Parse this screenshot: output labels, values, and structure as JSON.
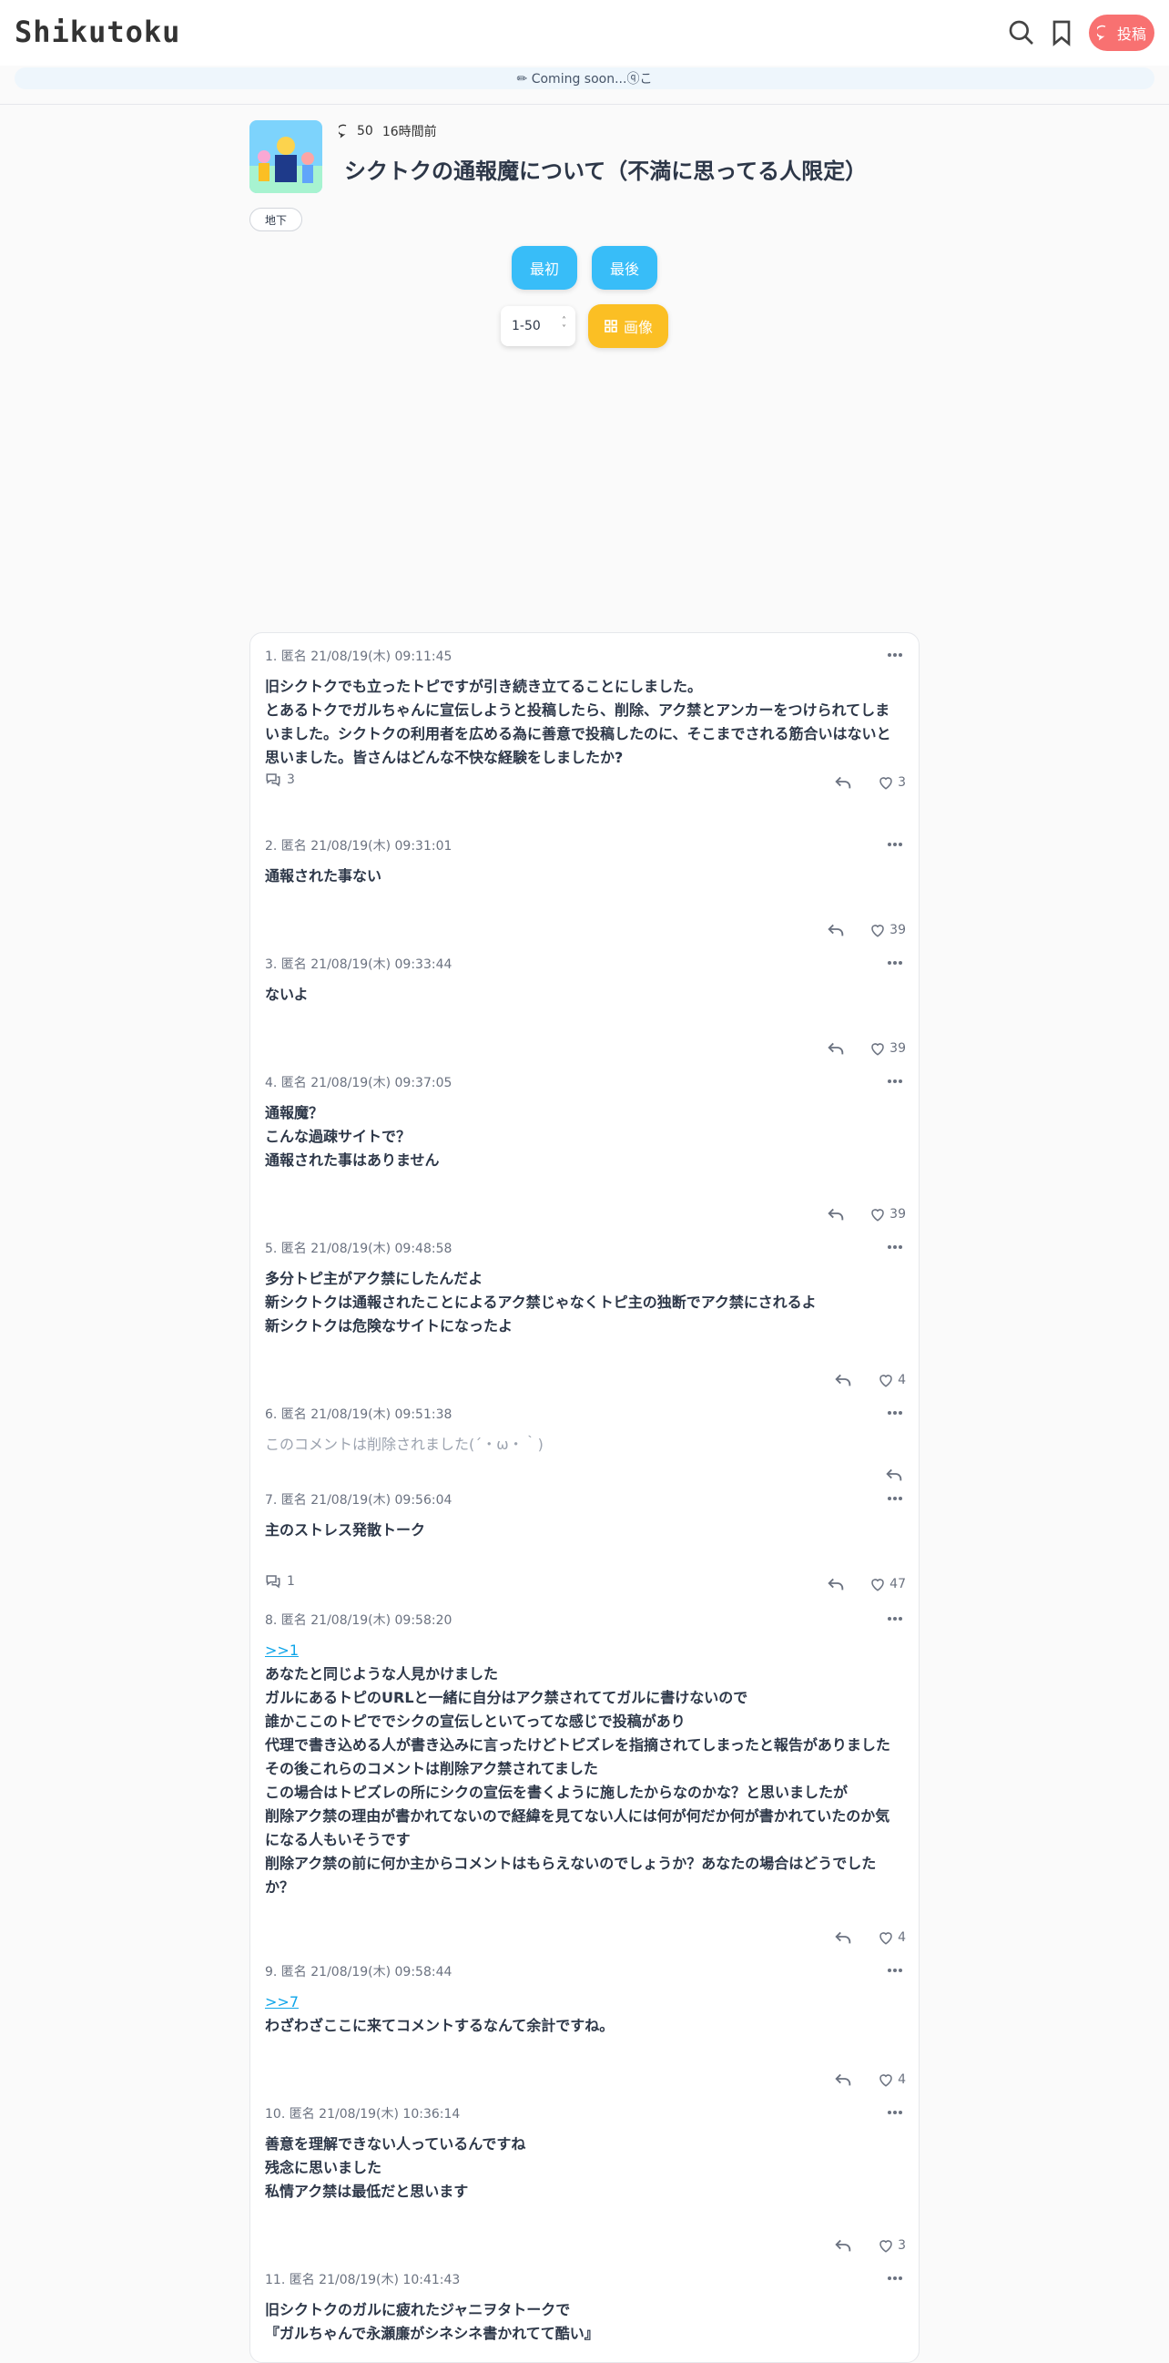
{
  "header": {
    "logo": "Shikutoku",
    "post_label": "投稿",
    "coming_soon": "✏ Coming soon...ⓠこ"
  },
  "thread": {
    "comment_count": "50",
    "age": "16時間前",
    "title": "シクトクの通報魔について（不満に思ってる人限定）",
    "tag": "地下",
    "first_label": "最初",
    "last_label": "最後",
    "range_label": "1-50",
    "image_label": "画像"
  },
  "colors": {
    "accent_blue": "#38bdf8",
    "accent_yellow": "#fbbf24",
    "post_red": "#f87171",
    "link": "#0ea5e9"
  },
  "comments": [
    {
      "meta": "1. 匿名  21/08/19(木) 09:11:45",
      "lines": [
        "旧シクトクでも立ったトピですが引き続き立てることにしました。",
        "とあるトクでガルちゃんに宣伝しようと投稿したら、削除、アク禁とアンカーをつけられてしま",
        "いました。シクトクの利用者を広める為に善意で投稿したのに、そこまでされる筋合いはないと",
        "思いました。皆さんはどんな不快な経験をしましたか?"
      ],
      "replies": "3",
      "likes": "3"
    },
    {
      "meta": "2. 匿名  21/08/19(木) 09:31:01",
      "lines": [
        "通報された事ない"
      ],
      "likes": "39"
    },
    {
      "meta": "3. 匿名  21/08/19(木) 09:33:44",
      "lines": [
        "ないよ"
      ],
      "likes": "39"
    },
    {
      "meta": "4. 匿名  21/08/19(木) 09:37:05",
      "lines": [
        "通報魔？",
        "こんな過疎サイトで？",
        "通報された事はありません"
      ],
      "likes": "39"
    },
    {
      "meta": "5. 匿名  21/08/19(木) 09:48:58",
      "lines": [
        "多分トピ主がアク禁にしたんだよ",
        "新シクトクは通報されたことによるアク禁じゃなくトピ主の独断でアク禁にされるよ",
        "新シクトクは危険なサイトになったよ"
      ],
      "likes": "4"
    },
    {
      "meta": "6. 匿名  21/08/19(木) 09:51:38",
      "lines": [
        "このコメントは削除されました(´・ω・｀)"
      ]
    },
    {
      "meta": "7. 匿名  21/08/19(木) 09:56:04",
      "lines": [
        "主のストレス発散トーク"
      ],
      "replies": "1",
      "likes": "47"
    },
    {
      "meta": "8. 匿名  21/08/19(木) 09:58:20",
      "anchor": ">>1",
      "lines": [
        "あなたと同じような人見かけました",
        "ガルにあるトピのURLと一緒に自分はアク禁されててガルに書けないので",
        "誰かここのトピででシクの宣伝しといてってな感じで投稿があり",
        "代理で書き込める人が書き込みに言ったけどトピズレを指摘されてしまったと報告がありました",
        "その後これらのコメントは削除アク禁されてました",
        "この場合はトピズレの所にシクの宣伝を書くように施したからなのかな？と思いましたが",
        "削除アク禁の理由が書かれてないので経緯を見てない人には何が何だか何が書かれていたのか気",
        "になる人もいそうです",
        "削除アク禁の前に何か主からコメントはもらえないのでしょうか？あなたの場合はどうでした",
        "か？"
      ],
      "likes": "4"
    },
    {
      "meta": "9. 匿名  21/08/19(木) 09:58:44",
      "anchor": ">>7",
      "lines": [
        "わざわざここに来てコメントするなんて余計ですね。"
      ],
      "likes": "4"
    },
    {
      "meta": "10. 匿名  21/08/19(木) 10:36:14",
      "lines": [
        "善意を理解できない人っているんですね",
        "残念に思いました",
        "私情アク禁は最低だと思います"
      ],
      "likes": "3"
    },
    {
      "meta": "11. 匿名  21/08/19(木) 10:41:43",
      "lines": [
        "旧シクトクのガルに疲れたジャニヲタトークで",
        "『ガルちゃんで永瀬廉がシネシネ書かれてて酷い』"
      ]
    }
  ]
}
